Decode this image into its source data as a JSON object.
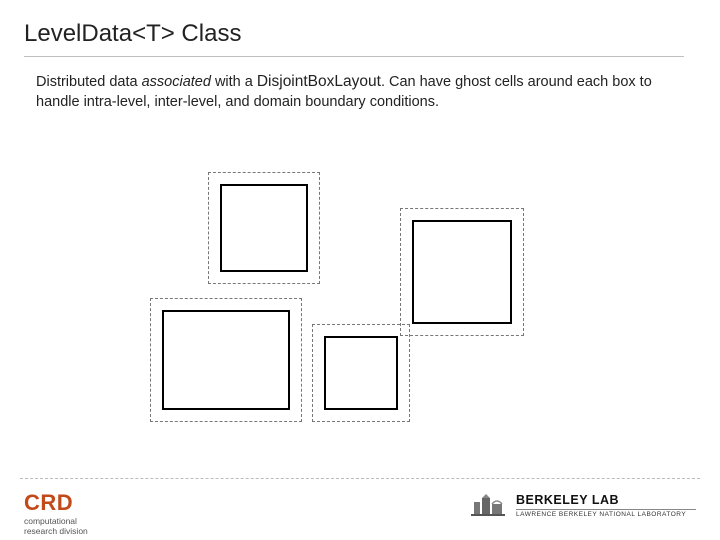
{
  "title": "LevelData<T> Class",
  "body": {
    "pre": "Distributed data ",
    "assoc": "associated",
    "mid": " with a ",
    "mono": "DisjointBoxLayout",
    "post": ". Can have ghost cells around each box to handle intra-level, inter-level, and domain boundary conditions."
  },
  "footer": {
    "left": {
      "main": "CRD",
      "sub1": "computational",
      "sub2": "research division"
    },
    "right": {
      "line1": "BERKELEY LAB",
      "line2": "LAWRENCE BERKELEY NATIONAL LABORATORY"
    }
  }
}
